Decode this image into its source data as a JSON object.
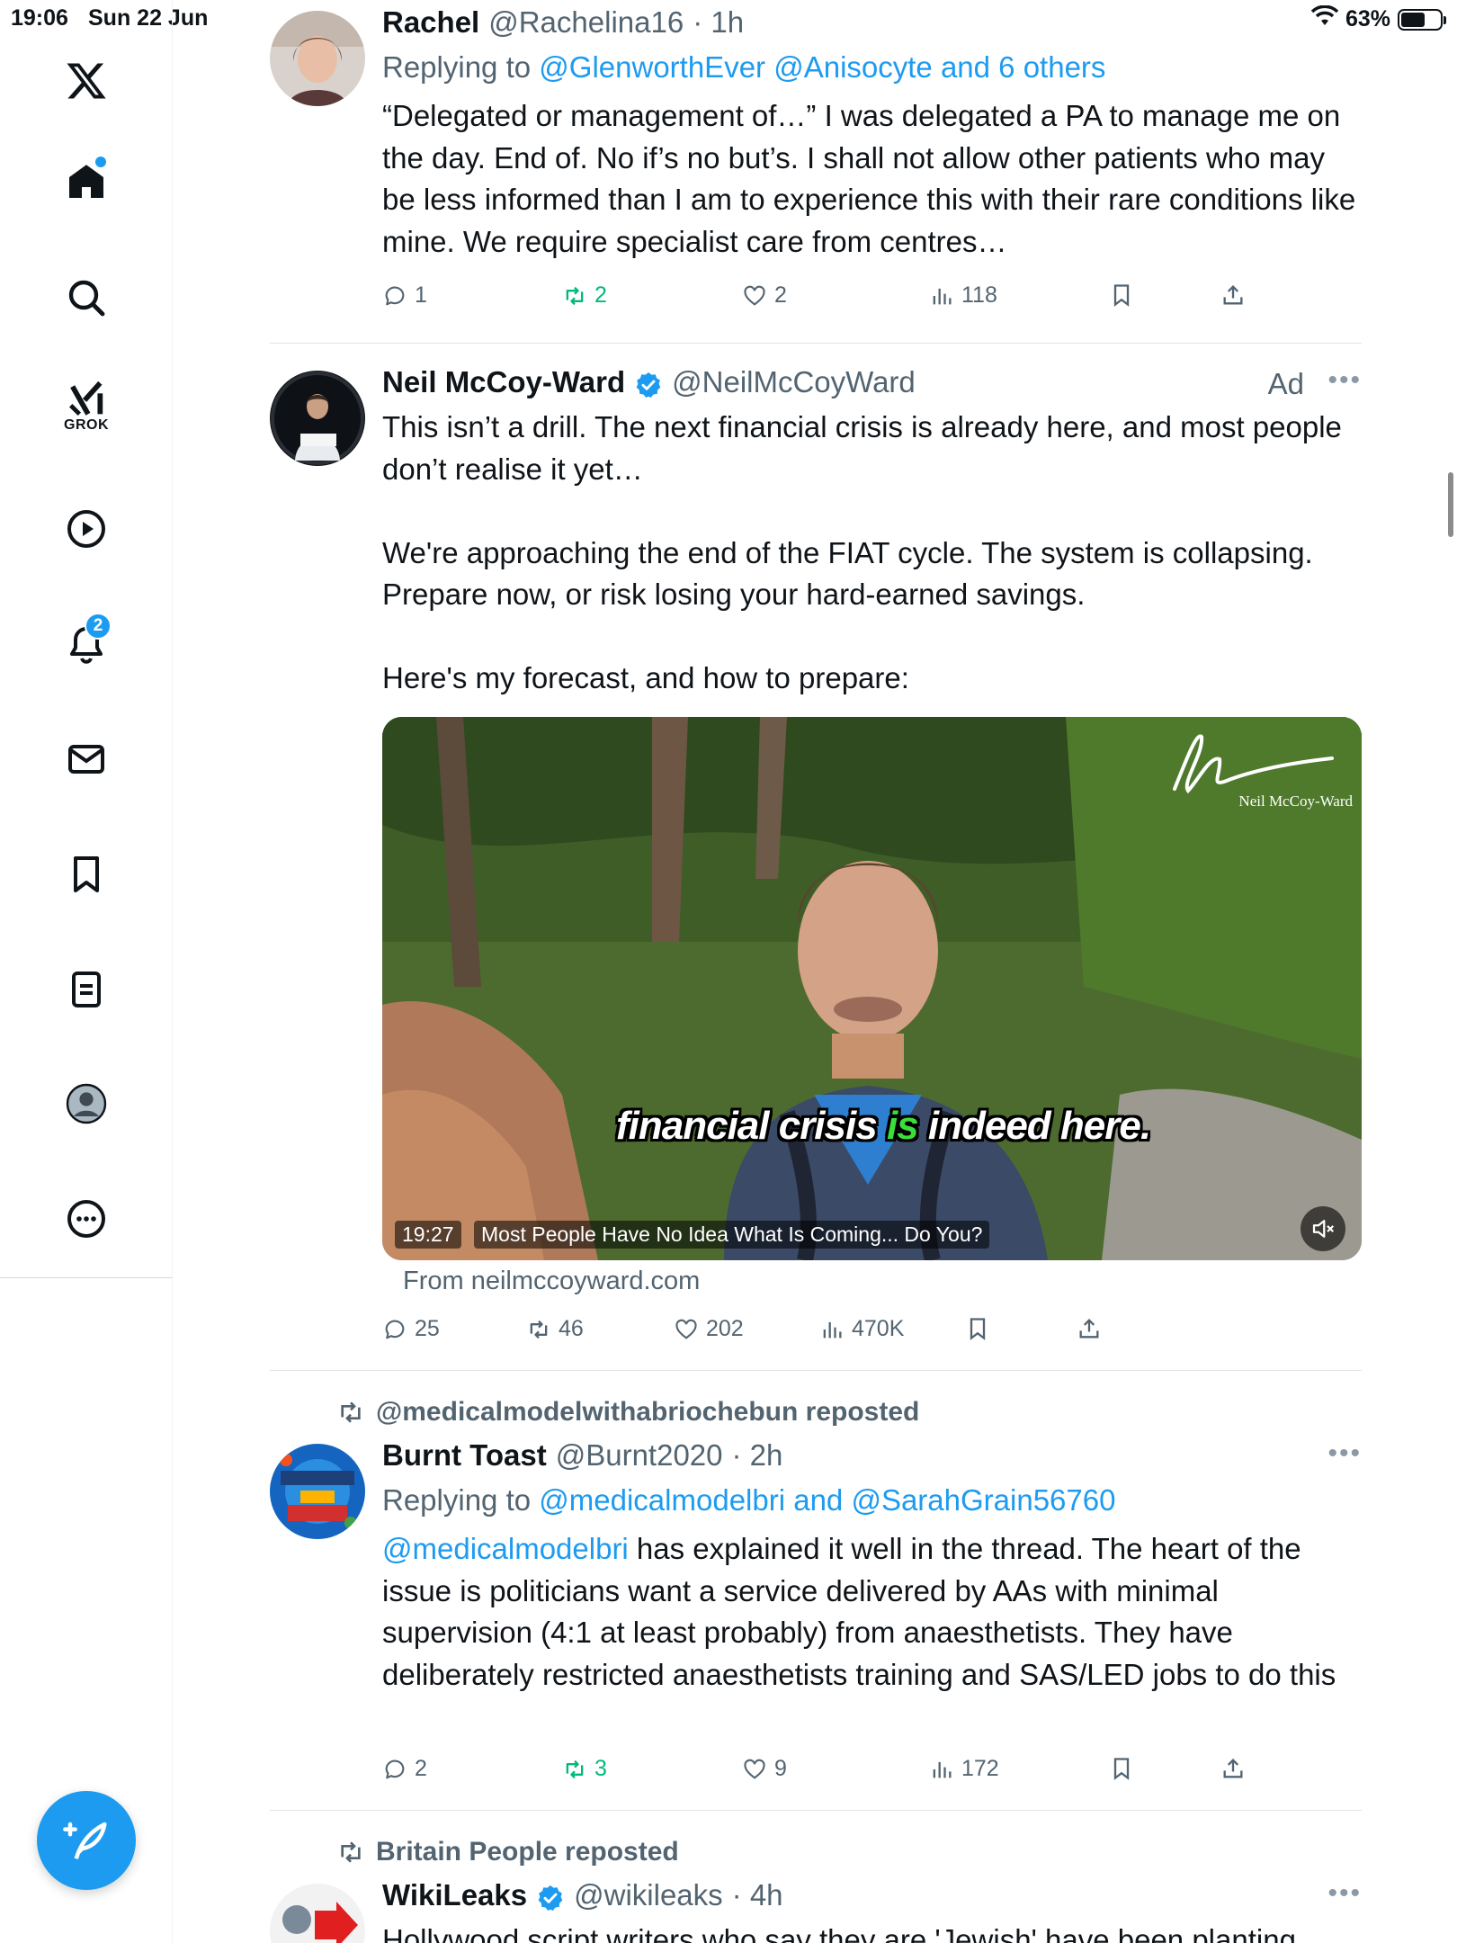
{
  "status_bar": {
    "time": "19:06",
    "date": "Sun 22 Jun",
    "battery": "63%",
    "battery_level": 0.63
  },
  "sidebar": {
    "grok_label": "GROK",
    "notifications_count": "2",
    "items": [
      "x-logo",
      "home",
      "search",
      "grok",
      "videos",
      "notifications",
      "messages",
      "bookmarks",
      "lists",
      "profile",
      "more"
    ]
  },
  "colors": {
    "accent": "#1d9bf0",
    "repost_green": "#00ba7c",
    "muted_text": "#536471",
    "text": "#0f1419"
  },
  "posts": [
    {
      "display_name": "Rachel",
      "handle": "@Rachelina16",
      "time": "· 1h",
      "replying_prefix": "Replying to",
      "replying_to": "@GlenworthEver @Anisocyte and 6 others",
      "text": "“Delegated or management of…” I was delegated a PA to manage me on the day. End of. No if’s no but’s. I shall not allow other patients who may be less informed than I am to experience this with their rare conditions like mine. We require specialist care from centres…",
      "replies": "1",
      "reposts": "2",
      "likes": "2",
      "views": "118"
    },
    {
      "display_name": "Neil McCoy-Ward",
      "handle": "@NeilMcCoyWard",
      "ad_label": "Ad",
      "text": "This isn’t a drill. The next financial crisis is already here, and most people don’t realise it yet…\n\nWe're approaching the end of the FIAT cycle. The system is collapsing. Prepare now, or risk losing your hard-earned savings.\n\nHere's my forecast, and how to prepare:",
      "video": {
        "caption_start": "financial crisis ",
        "caption_highlight": "is",
        "caption_end": " indeed here.",
        "duration": "19:27",
        "title": "Most People Have No Idea What Is Coming... Do You?",
        "watermark": "Neil McCoy-Ward"
      },
      "from": "From neilmccoyward.com",
      "replies": "25",
      "reposts": "46",
      "likes": "202",
      "views": "470K"
    },
    {
      "repost_by": "@medicalmodelwithabriochebun reposted",
      "display_name": "Burnt Toast",
      "handle": "@Burnt2020",
      "time": "· 2h",
      "replying_prefix": "Replying to",
      "replying_to": "@medicalmodelbri and @SarahGrain56760",
      "mention": "@medicalmodelbri",
      "text": " has explained it well in the thread. The heart of the issue is politicians want a service delivered by AAs with minimal supervision (4:1 at least probably) from anaesthetists. They have deliberately restricted anaesthetists training and SAS/LED jobs to do this",
      "replies": "2",
      "reposts": "3",
      "likes": "9",
      "views": "172"
    },
    {
      "repost_by": "Britain People reposted",
      "display_name": "WikiLeaks",
      "handle": "@wikileaks",
      "time": "· 4h",
      "text": "Hollywood script writers who say they are 'Jewish' have been planting"
    }
  ]
}
